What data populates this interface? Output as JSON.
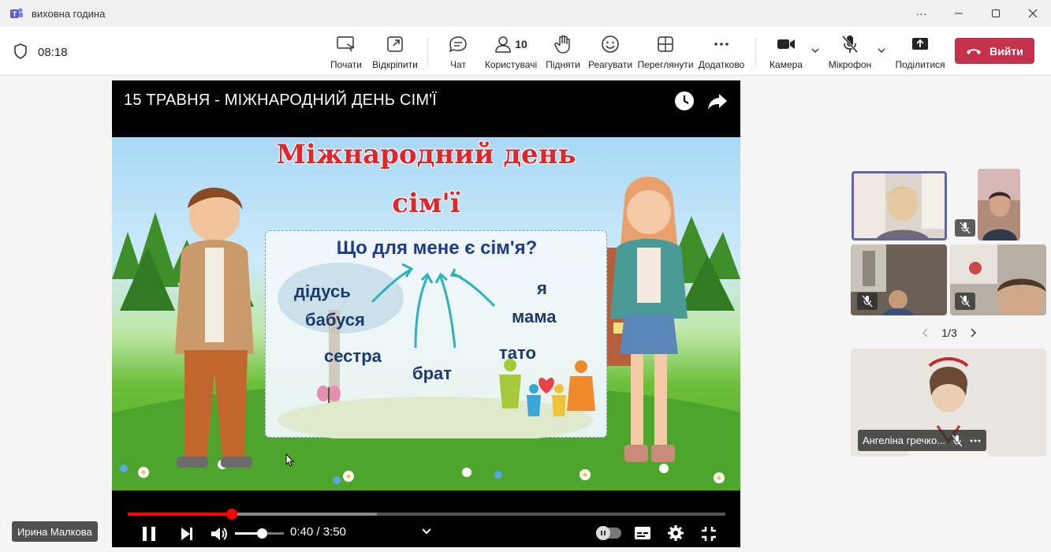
{
  "window": {
    "title": "виховна година",
    "controls": [
      "more-icon",
      "minimize-icon",
      "maximize-icon",
      "close-icon"
    ]
  },
  "toolbar": {
    "timer": "08:18",
    "buttons": {
      "start": "Почати",
      "popout": "Відкріпити",
      "chat": "Чат",
      "people": "Користувачі",
      "people_count": "10",
      "raise": "Підняти",
      "react": "Реагувати",
      "view": "Переглянути",
      "more": "Додатково",
      "camera": "Камера",
      "mic": "Мікрофон",
      "share": "Поділитися"
    },
    "leave": "Вийти"
  },
  "video": {
    "title": "15 ТРАВНЯ - МІЖНАРОДНИЙ ДЕНЬ СІМ'Ї",
    "time": "0:40 / 3:50",
    "progress": 0.174,
    "buffered": 0.417,
    "volume": 0.55,
    "slide": {
      "title_line1": "Міжнародний день",
      "title_line2": "сім'ї",
      "question": "Що для мене є сім'я?",
      "words": {
        "grandpa": "дідусь",
        "grandma": "бабуся",
        "sister": "сестра",
        "brother": "брат",
        "me": "я",
        "mom": "мама",
        "dad": "тато"
      }
    }
  },
  "presenter": {
    "name": "Ирина Малкова"
  },
  "participants": {
    "pager": "1/3",
    "spotlight_name": "Ангеліна гречко..."
  },
  "colors": {
    "leave": "#c4314b",
    "progress": "#ff0000",
    "active_border": "#6264a7"
  }
}
